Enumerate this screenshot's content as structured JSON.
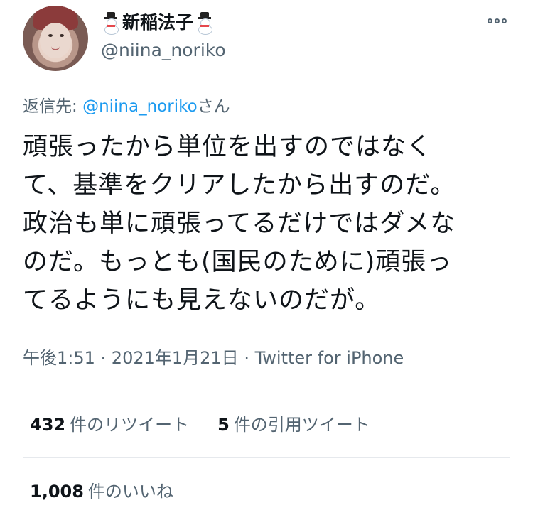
{
  "user": {
    "display_name": "新稲法子",
    "handle": "@niina_noriko",
    "name_emoji": "snowman-icon"
  },
  "reply": {
    "prefix": "返信先: ",
    "mention": "@niina_noriko",
    "suffix": "さん"
  },
  "tweet": {
    "text": "頑張ったから単位を出すのではなく\nて、基準をクリアしたから出すのだ。\n政治も単に頑張ってるだけではダメな\nのだ。もっとも(国民のために)頑張っ\nてるようにも見えないのだが。"
  },
  "meta": {
    "time": "午後1:51",
    "separator": " · ",
    "date": "2021年1月21日",
    "separator2": " · ",
    "source": "Twitter for iPhone"
  },
  "stats": {
    "retweets_count": "432",
    "retweets_label": "件のリツイート",
    "quotes_count": "5",
    "quotes_label": "件の引用ツイート",
    "likes_count": "1,008",
    "likes_label": "件のいいね"
  },
  "colors": {
    "link": "#1d9bf0",
    "secondary": "#536471",
    "text": "#0f1419"
  }
}
